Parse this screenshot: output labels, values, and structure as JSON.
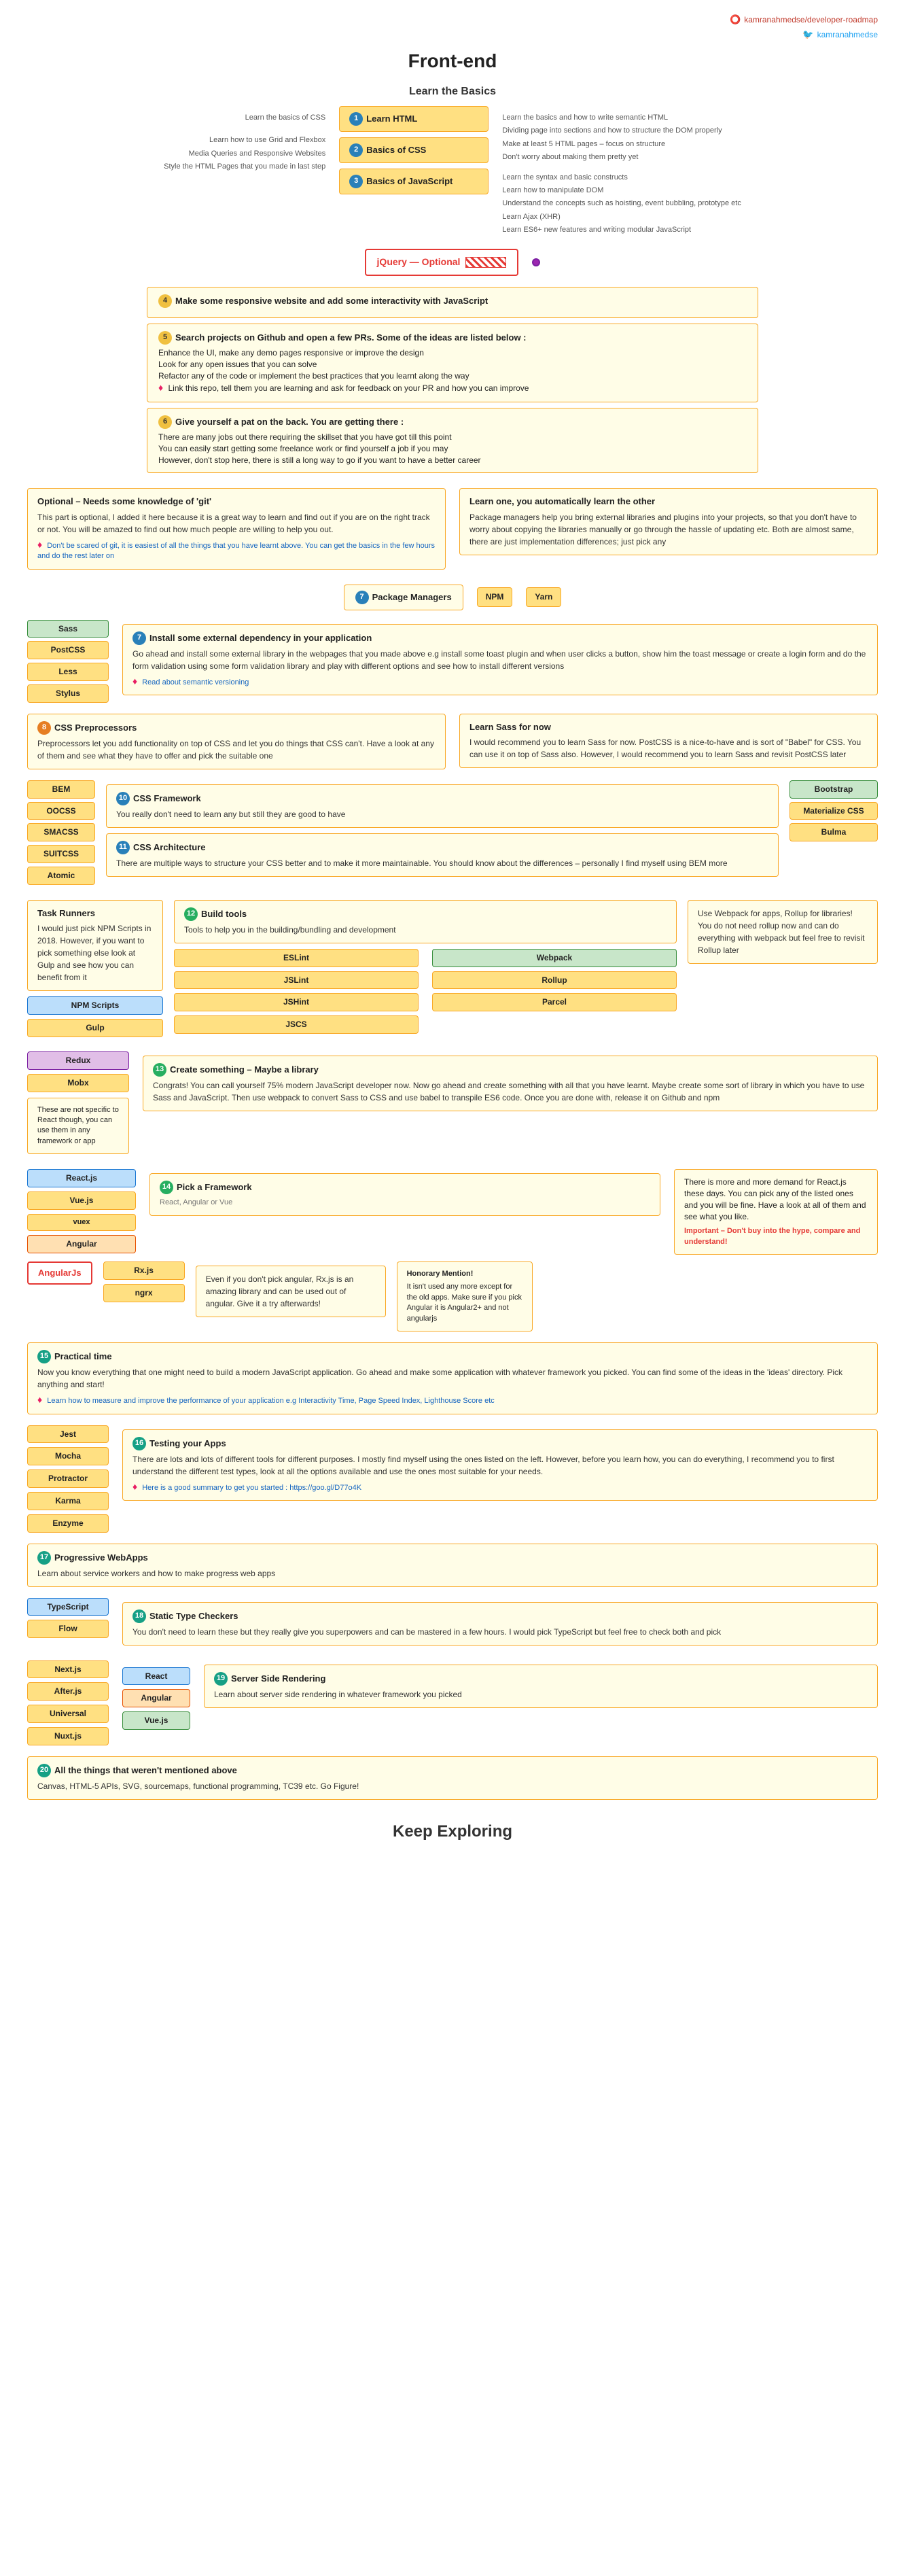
{
  "header": {
    "title": "Front-end",
    "github_link": "kamranahmedse/developer-roadmap",
    "twitter_link": "kamranahmedse"
  },
  "learn_basics": {
    "heading": "Learn the Basics",
    "items": [
      {
        "num": "1",
        "label": "Learn HTML"
      },
      {
        "num": "2",
        "label": "Basics of CSS"
      },
      {
        "num": "3",
        "label": "Basics of JavaScript"
      }
    ],
    "left_notes": [
      "Learn the basics of CSS",
      "Learn how to use Grid and Flexbox",
      "Media Queries and Responsive Websites",
      "Style the HTML Pages that you made in last step"
    ],
    "html_notes": [
      "Learn the basics and how to write semantic HTML",
      "Dividing page into sections and how to structure the DOM properly",
      "Make at least 5 HTML pages – focus on structure",
      "Don't worry about making them pretty yet"
    ],
    "js_notes": [
      "Learn the syntax and basic constructs",
      "Learn how to manipulate DOM",
      "Understand the concepts such as hoisting, event bubbling, prototype etc",
      "Learn Ajax (XHR)",
      "Learn ES6+ new features and writing modular JavaScript"
    ]
  },
  "jquery_optional": "jQuery — Optional",
  "step4": {
    "num": "4",
    "text": "Make some responsive website and add some interactivity with JavaScript"
  },
  "step5": {
    "num": "5",
    "text": "Search projects on Github and open a few PRs. Some of the ideas are listed below :",
    "items": [
      "Enhance the UI, make any demo pages responsive or improve the design",
      "Look for any open issues that you can solve",
      "Refactor any of the code or implement the best practices that you learnt along the way"
    ],
    "link_text": "Link this repo, tell them you are learning and ask for feedback on your PR and how you can improve"
  },
  "step6": {
    "num": "6",
    "title": "Give yourself a pat on the back. You are getting there :",
    "items": [
      "There are many jobs out there requiring the skillset that you have got till this point",
      "You can easily start getting some freelance work or find yourself a job if you may",
      "However, don't stop here, there is still a long way to go if you want to have a better career"
    ]
  },
  "optional_git": {
    "title": "Optional – Needs some knowledge of 'git'",
    "text": "This part is optional, I added it here because it is a great way to learn and find out if you are on the right track or not. You will be amazed to find out how much people are willing to help you out.",
    "link_text": "Don't be scared of git, it is easiest of all the things that you have learnt above. You can get the basics in the few hours and do the rest later on"
  },
  "learn_other": {
    "title": "Learn one, you automatically learn the other",
    "text": "Package managers help you bring external libraries and plugins into your projects, so that you don't have to worry about copying the libraries manually or go through the hassle of updating etc. Both are almost same, there are just implementation differences; just pick any"
  },
  "package_managers": {
    "num": "7",
    "label": "Package Managers",
    "npm": "NPM",
    "yarn": "Yarn"
  },
  "step_install": {
    "num": "7",
    "title": "Install some external dependency in your application",
    "text": "Go ahead and install some external library in the webpages that you made above e.g install some toast plugin and when user clicks a button, show him the toast message or create a login form and do the form validation using some form validation library and play with different options and see how to install different versions",
    "link_text": "Read about semantic versioning"
  },
  "css_preprocessors": {
    "num": "8",
    "title": "CSS Preprocessors",
    "text": "Preprocessors let you add functionality on top of CSS and let you do things that CSS can't. Have a look at any of them and see what they have to offer and pick the suitable one",
    "items": [
      "Sass",
      "PostCSS",
      "Less",
      "Stylus"
    ],
    "sass_note_title": "Learn Sass for now",
    "sass_note": "I would recommend you to learn Sass for now. PostCSS is a nice-to-have and is sort of \"Babel\" for CSS. You can use it on top of Sass also. However, I would recommend you to learn Sass and revisit PostCSS later"
  },
  "css_framework": {
    "num": "10",
    "title": "CSS Framework",
    "text": "You really don't need to learn any but still they are good to have",
    "items": [
      "BEM",
      "OOCSS",
      "SMACSS",
      "SUITCSS",
      "Atomic"
    ],
    "right_items": [
      "Bootstrap",
      "Materialize CSS",
      "Bulma"
    ]
  },
  "css_architecture": {
    "num": "11",
    "title": "CSS Architecture",
    "text": "There are multiple ways to structure your CSS better and to make it more maintainable. You should know about the differences – personally I find myself using BEM more"
  },
  "build_tools": {
    "task_runners": {
      "title": "Task Runners",
      "text": "I would just pick NPM Scripts in 2018. However, if you want to pick something else look at Gulp and see how you can benefit from it"
    },
    "npm_scripts": "NPM Scripts",
    "gulp": "Gulp",
    "main_num": "12",
    "main_title": "Build tools",
    "main_text": "Tools to help you in the building/bundling and development",
    "linters": [
      "ESLint",
      "JSLint",
      "JSHint",
      "JSCS"
    ],
    "bundlers": [
      "Webpack",
      "Rollup",
      "Parcel"
    ],
    "bundler_note": "Use Webpack for apps, Rollup for libraries! You do not need rollup now and can do everything with webpack but feel free to revisit Rollup later"
  },
  "create_something": {
    "num": "13",
    "title": "Create something – Maybe a library",
    "text": "Congrats! You can call yourself 75% modern JavaScript developer now. Now go ahead and create something with all that you have learnt. Maybe create some sort of library in which you have to use Sass and JavaScript. Then use webpack to convert Sass to CSS and use babel to transpile ES6 code. Once you are done with, release it on Github and npm",
    "frameworks": [
      "Redux",
      "Mobx"
    ],
    "framework_note": "These are not specific to React though, you can use them in any framework or app"
  },
  "pick_framework": {
    "num": "14",
    "title": "Pick a Framework",
    "subtitle": "React, Angular or Vue",
    "items_left": [
      "React.js",
      "Vue.js"
    ],
    "items_right": [
      "Angular"
    ],
    "vuex": "vuex",
    "react_note_title": "",
    "react_note": "There is more and more demand for React.js these days. You can pick any of the listed ones and you will be fine. Have a look at all of them and see what you like.",
    "react_important": "Important – Don't buy into the hype, compare and understand!"
  },
  "angular_optional": {
    "label": "AngularJs",
    "box_text": "Even if you don't pick angular, Rx.js is an amazing library and can be used out of angular. Give it a try afterwards!",
    "items": [
      "Rx.js",
      "ngrx"
    ]
  },
  "honorary_mention": {
    "title": "Honorary Mention!",
    "text": "It isn't used any more except for the old apps. Make sure if you pick Angular it is Angular2+ and not angularjs"
  },
  "practical_time": {
    "num": "15",
    "title": "Practical time",
    "text": "Now you know everything that one might need to build a modern JavaScript application. Go ahead and make some application with whatever framework you picked. You can find some of the ideas in the 'ideas' directory. Pick anything and start!",
    "link_text": "Learn how to measure and improve the performance of your application e.g Interactivity Time, Page Speed Index, Lighthouse Score etc"
  },
  "testing_apps": {
    "num": "16",
    "title": "Testing your Apps",
    "text": "There are lots and lots of different tools for different purposes. I mostly find myself using the ones listed on the left. However, before you learn how, you can do everything, I recommend you to first understand the different test types, look at all the options available and use the ones most suitable for your needs.",
    "link_text": "Here is a good summary to get you started : https://goo.gl/D77o4K",
    "items": [
      "Jest",
      "Mocha",
      "Protractor",
      "Karma",
      "Enzyme"
    ]
  },
  "progressive_webapps": {
    "num": "17",
    "title": "Progressive WebApps",
    "text": "Learn about service workers and how to make progress web apps"
  },
  "static_type_checkers": {
    "num": "18",
    "title": "Static Type Checkers",
    "text": "You don't need to learn these but they really give you superpowers and can be mastered in a few hours. I would pick TypeScript but feel free to check both and pick",
    "items": [
      "TypeScript",
      "Flow"
    ]
  },
  "server_side_rendering": {
    "num": "19",
    "title": "Server Side Rendering",
    "text": "Learn about server side rendering in whatever framework you picked",
    "items_left": [
      "Next.js",
      "After.js",
      "Universal",
      "Nuxt.js"
    ],
    "items_right": [
      "React",
      "Angular",
      "Vue.js"
    ]
  },
  "all_the_things": {
    "num": "20",
    "title": "All the things that weren't mentioned above",
    "text": "Canvas, HTML-5 APIs, SVG, sourcemaps, functional programming, TC39 etc. Go Figure!"
  },
  "footer": {
    "title": "Keep Exploring"
  },
  "icons": {
    "github": "🔴",
    "twitter": "🐦",
    "pink_dot": "♦",
    "arrow": "→",
    "check": "✓"
  }
}
